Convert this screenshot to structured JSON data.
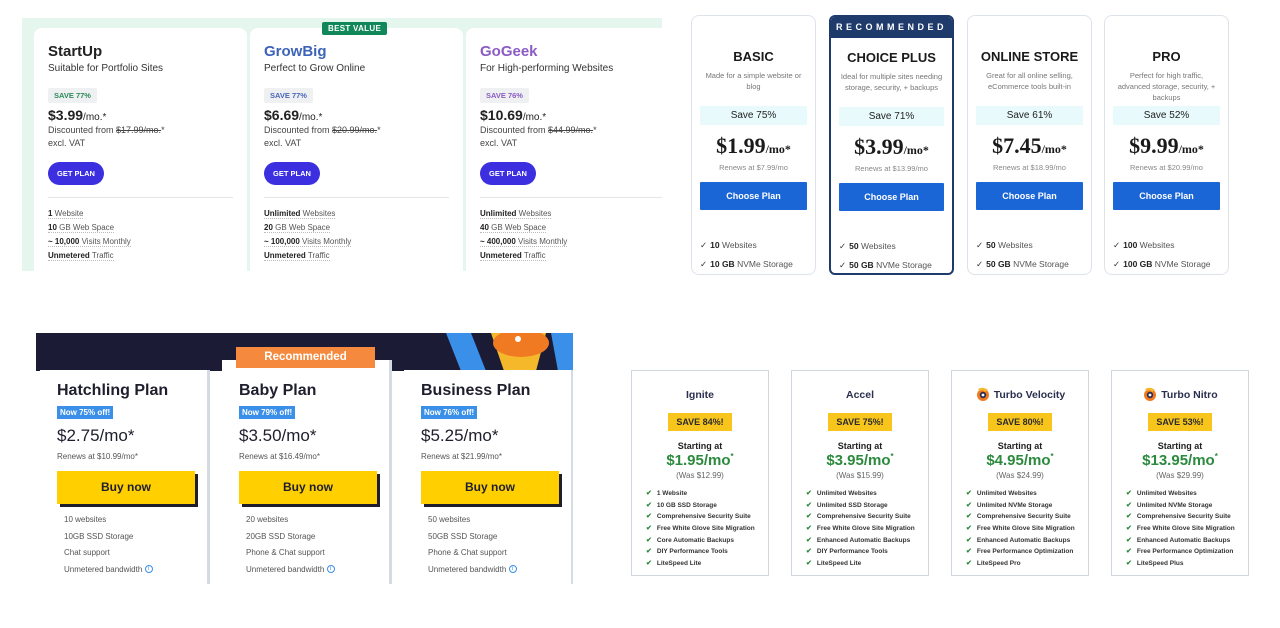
{
  "siteground": {
    "best_value_badge": "BEST VALUE",
    "plans": [
      {
        "name": "StartUp",
        "name_color": "#222222",
        "subtitle": "Suitable for Portfolio Sites",
        "save": "SAVE 77%",
        "save_color": "#2e8a5a",
        "price": "$3.99",
        "price_unit": "/mo.*",
        "discount_prefix": "Discounted from ",
        "original_price": "$17.99/mo.",
        "discount_suffix": "*",
        "vat": "excl. VAT",
        "button": "GET PLAN",
        "features": [
          {
            "bold": "1",
            "text": " Website"
          },
          {
            "bold": "10",
            "text": " GB Web Space"
          },
          {
            "bold": "~ 10,000",
            "text": " Visits Monthly"
          },
          {
            "bold": "Unmetered",
            "text": " Traffic"
          }
        ]
      },
      {
        "name": "GrowBig",
        "name_color": "#3d63b8",
        "subtitle": "Perfect to Grow Online",
        "save": "SAVE 77%",
        "save_color": "#4a66b8",
        "price": "$6.69",
        "price_unit": "/mo.*",
        "discount_prefix": "Discounted from ",
        "original_price": "$20.99/mo.",
        "discount_suffix": "*",
        "vat": "excl. VAT",
        "button": "GET PLAN",
        "features": [
          {
            "bold": "Unlimited",
            "text": " Websites"
          },
          {
            "bold": "20",
            "text": " GB Web Space"
          },
          {
            "bold": "~ 100,000",
            "text": " Visits Monthly"
          },
          {
            "bold": "Unmetered",
            "text": " Traffic"
          }
        ]
      },
      {
        "name": "GoGeek",
        "name_color": "#8a5cc4",
        "subtitle": "For High-performing Websites",
        "save": "SAVE 76%",
        "save_color": "#8a5cc4",
        "price": "$10.69",
        "price_unit": "/mo.*",
        "discount_prefix": "Discounted from ",
        "original_price": "$44.99/mo.",
        "discount_suffix": "*",
        "vat": "excl. VAT",
        "button": "GET PLAN",
        "features": [
          {
            "bold": "Unlimited",
            "text": " Websites"
          },
          {
            "bold": "40",
            "text": " GB Web Space"
          },
          {
            "bold": "~ 400,000",
            "text": " Visits Monthly"
          },
          {
            "bold": "Unmetered",
            "text": " Traffic"
          }
        ]
      }
    ]
  },
  "bluehost": {
    "recommended_label": "RECOMMENDED",
    "plans": [
      {
        "name": "BASIC",
        "description": "Made for a simple website or blog",
        "save": "Save 75%",
        "price": "$1.99",
        "price_unit": "/mo*",
        "renew": "Renews at $7.99/mo",
        "button": "Choose Plan",
        "features": [
          {
            "bold": "10",
            "text": " Websites"
          },
          {
            "bold": "10 GB",
            "text": " NVMe Storage"
          }
        ]
      },
      {
        "name": "CHOICE PLUS",
        "description": "Ideal for multiple sites needing storage, security, + backups",
        "save": "Save 71%",
        "price": "$3.99",
        "price_unit": "/mo*",
        "renew": "Renews at $13.99/mo",
        "button": "Choose Plan",
        "features": [
          {
            "bold": "50",
            "text": " Websites"
          },
          {
            "bold": "50 GB",
            "text": " NVMe Storage"
          }
        ]
      },
      {
        "name": "ONLINE STORE",
        "description": "Great for all online selling, eCommerce tools built-in",
        "save": "Save 61%",
        "price": "$7.45",
        "price_unit": "/mo*",
        "renew": "Renews at $18.99/mo",
        "button": "Choose Plan",
        "features": [
          {
            "bold": "50",
            "text": " Websites"
          },
          {
            "bold": "50 GB",
            "text": " NVMe Storage"
          }
        ]
      },
      {
        "name": "PRO",
        "description": "Perfect for high traffic, advanced storage, security, + backups",
        "save": "Save 52%",
        "price": "$9.99",
        "price_unit": "/mo*",
        "renew": "Renews at $20.99/mo",
        "button": "Choose Plan",
        "features": [
          {
            "bold": "100",
            "text": " Websites"
          },
          {
            "bold": "100 GB",
            "text": " NVMe Storage"
          }
        ]
      }
    ]
  },
  "hostgator": {
    "recommended_label": "Recommended",
    "plans": [
      {
        "name": "Hatchling Plan",
        "off": "Now 75% off!",
        "price": "$2.75/mo*",
        "renew": "Renews at $10.99/mo*",
        "button": "Buy now",
        "features": [
          "10 websites",
          "10GB SSD Storage",
          "Chat support",
          "Unmetered bandwidth"
        ]
      },
      {
        "name": "Baby Plan",
        "off": "Now 79% off!",
        "price": "$3.50/mo*",
        "renew": "Renews at $16.49/mo*",
        "button": "Buy now",
        "features": [
          "20 websites",
          "20GB SSD Storage",
          "Phone & Chat support",
          "Unmetered bandwidth"
        ]
      },
      {
        "name": "Business Plan",
        "off": "Now 76% off!",
        "price": "$5.25/mo*",
        "renew": "Renews at $21.99/mo*",
        "button": "Buy now",
        "features": [
          "50 websites",
          "50GB SSD Storage",
          "Phone & Chat support",
          "Unmetered bandwidth"
        ]
      }
    ]
  },
  "a2hosting": {
    "plans": [
      {
        "name": "Ignite",
        "has_logo": false,
        "save": "SAVE 84%!",
        "starting": "Starting at",
        "price": "$1.95/mo",
        "asterisk": "*",
        "was": "(Was $12.99)",
        "features": [
          "1 Website",
          "10 GB SSD Storage",
          "Comprehensive Security Suite",
          "Free White Glove Site Migration",
          "Core Automatic Backups",
          "DIY Performance Tools",
          "LiteSpeed Lite"
        ]
      },
      {
        "name": "Accel",
        "has_logo": false,
        "save": "SAVE 75%!",
        "starting": "Starting at",
        "price": "$3.95/mo",
        "asterisk": "*",
        "was": "(Was $15.99)",
        "features": [
          "Unlimited Websites",
          "Unlimited SSD Storage",
          "Comprehensive Security Suite",
          "Free White Glove Site Migration",
          "Enhanced Automatic Backups",
          "DIY Performance Tools",
          "LiteSpeed Lite"
        ]
      },
      {
        "name": "Turbo Velocity",
        "has_logo": true,
        "save": "SAVE 80%!",
        "starting": "Starting at",
        "price": "$4.95/mo",
        "asterisk": "*",
        "was": "(Was $24.99)",
        "features": [
          "Unlimited Websites",
          "Unlimited NVMe Storage",
          "Comprehensive Security Suite",
          "Free White Glove Site Migration",
          "Enhanced Automatic Backups",
          "Free Performance Optimization",
          "LiteSpeed Pro"
        ]
      },
      {
        "name": "Turbo Nitro",
        "has_logo": true,
        "save": "SAVE 53%!",
        "starting": "Starting at",
        "price": "$13.95/mo",
        "asterisk": "*",
        "was": "(Was $29.99)",
        "features": [
          "Unlimited Websites",
          "Unlimited NVMe Storage",
          "Comprehensive Security Suite",
          "Free White Glove Site Migration",
          "Enhanced Automatic Backups",
          "Free Performance Optimization",
          "LiteSpeed Plus"
        ]
      }
    ]
  }
}
